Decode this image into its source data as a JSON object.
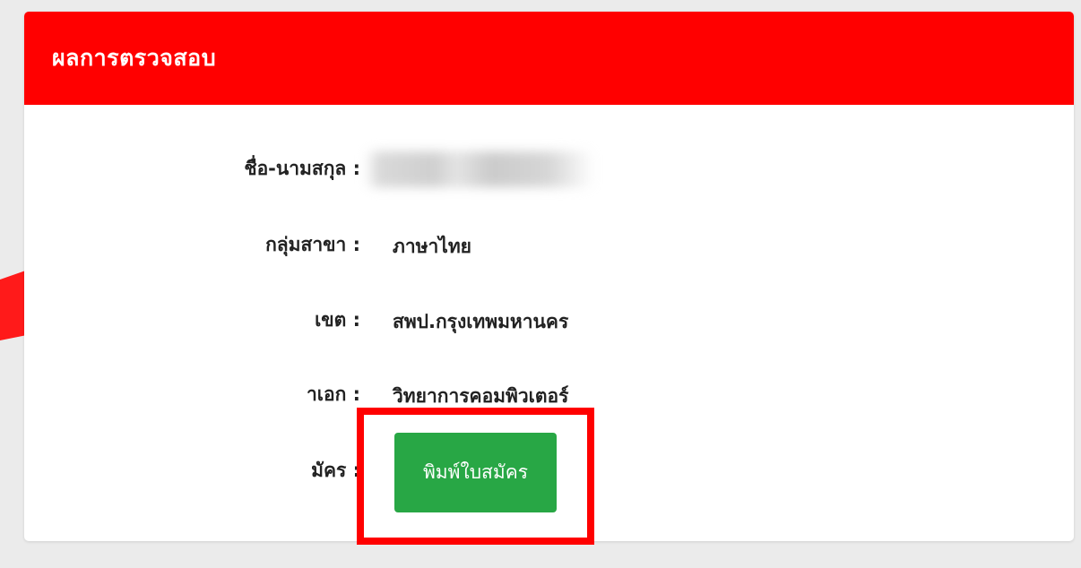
{
  "header": {
    "title": "ผลการตรวจสอบ"
  },
  "fields": [
    {
      "label": "ชื่อ-นามสกุล :",
      "value": ""
    },
    {
      "label": "กลุ่มสาขา :",
      "value": "ภาษาไทย"
    },
    {
      "label": "เขต :",
      "value": "สพป.กรุงเทพมหานคร"
    },
    {
      "label": "าเอก :",
      "value": "วิทยาการคอมพิวเตอร์"
    },
    {
      "label": "มัคร :",
      "value": ""
    }
  ],
  "print_button": {
    "label": "พิมพ์ใบสมัคร"
  },
  "colors": {
    "header_bg": "#ff0000",
    "button_bg": "#28a745",
    "highlight": "#ff0000",
    "arrow": "#ff1a1a"
  }
}
